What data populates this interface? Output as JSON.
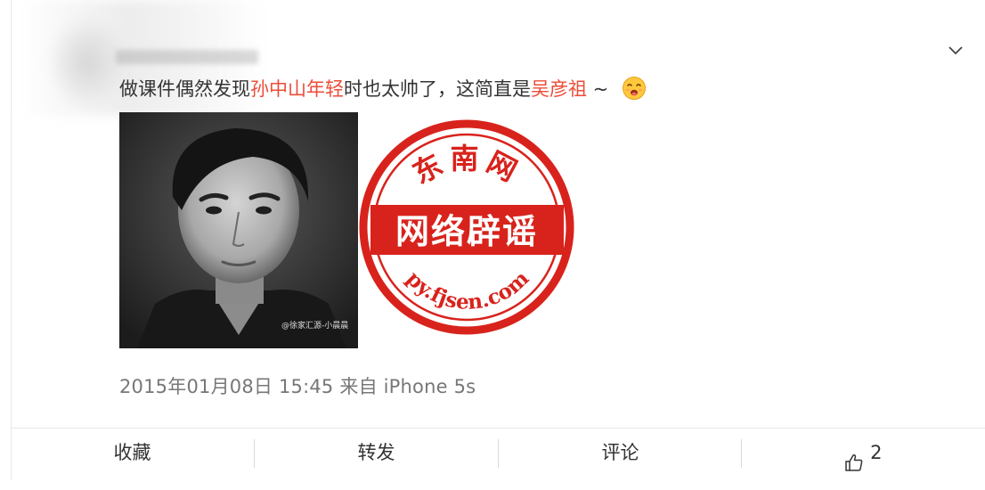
{
  "post": {
    "text_before": "做课件偶然发现",
    "highlight1": "孙中山年轻",
    "text_middle": "时也太帅了，这简直是",
    "highlight2": "吴彦祖",
    "text_after": " ~ ",
    "emoji": "drooling-face"
  },
  "image": {
    "watermark": "@徐家汇源-小晨晨",
    "stamp": {
      "top_text": "东南网",
      "center_text": "网络辟谣",
      "bottom_text": "py.fjsen.com"
    }
  },
  "meta": {
    "timestamp": "2015年01月08日 15:45",
    "source": "来自 iPhone 5s"
  },
  "actions": {
    "favorite": "收藏",
    "repost": "转发",
    "comment": "评论",
    "like_count": "2"
  },
  "colors": {
    "highlight": "#eb4d38",
    "stamp_red": "#d8231c",
    "meta_text": "#777777"
  }
}
